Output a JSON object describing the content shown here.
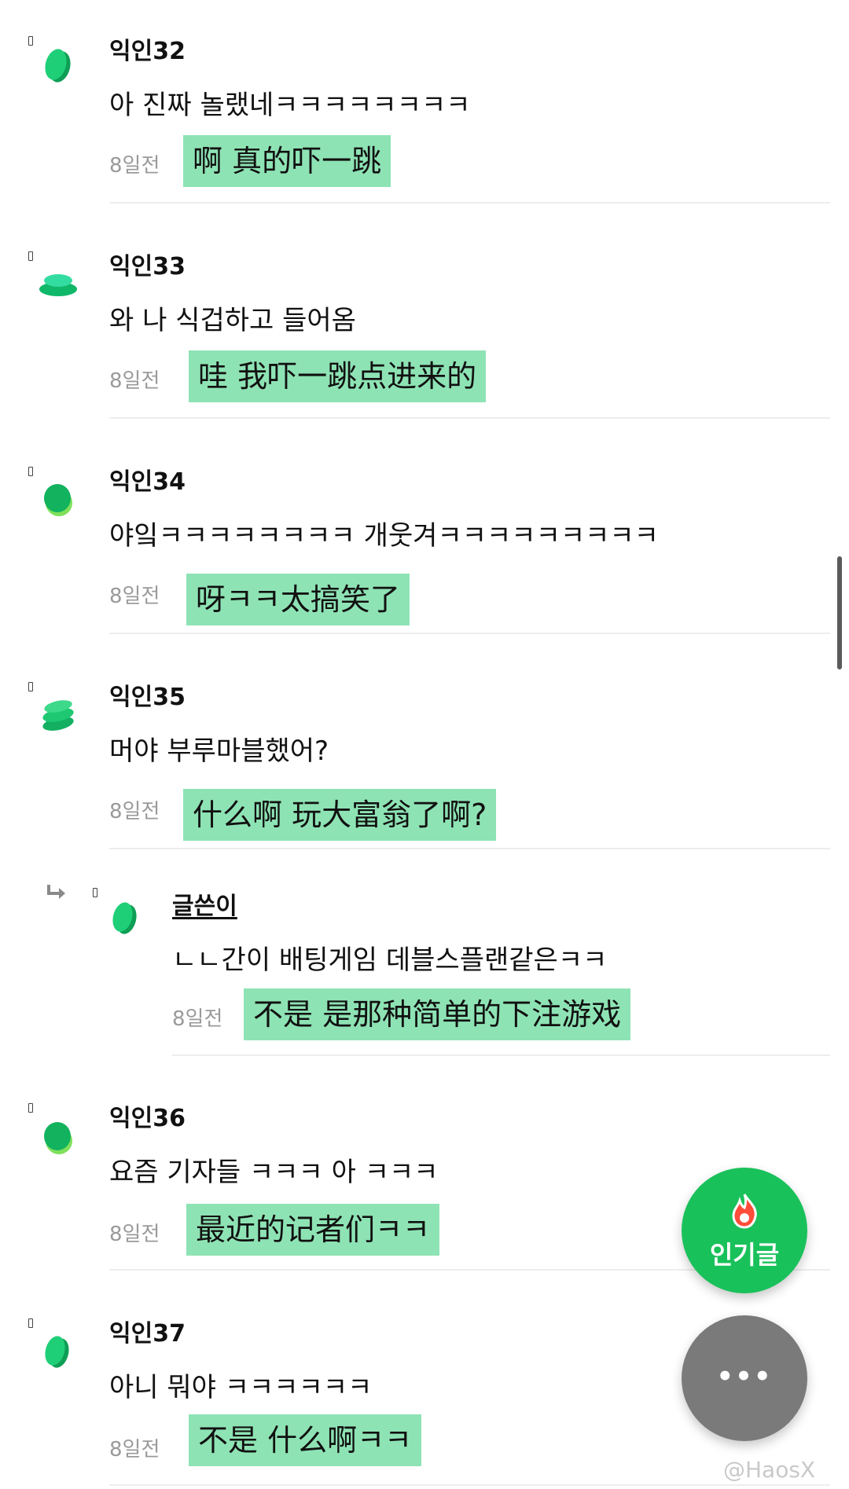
{
  "comments": [
    {
      "name": "익인32",
      "text": "아 진짜 놀랬네ㅋㅋㅋㅋㅋㅋㅋㅋ",
      "date": "8일전",
      "translation": "啊 真的吓一跳"
    },
    {
      "name": "익인33",
      "text": "와 나 식겁하고 들어옴",
      "date": "8일전",
      "translation": "哇 我吓一跳点进来的"
    },
    {
      "name": "익인34",
      "text": "야잌ㅋㅋㅋㅋㅋㅋㅋㅋ 개웃겨ㅋㅋㅋㅋㅋㅋㅋㅋㅋ",
      "date": "8일전",
      "translation": "呀ㅋㅋ太搞笑了"
    },
    {
      "name": "익인35",
      "text": "머야 부루마블했어?",
      "date": "8일전",
      "translation": "什么啊 玩大富翁了啊?"
    },
    {
      "name": "글쓴이",
      "text": "ㄴㄴ간이 배팅게임 데블스플랜같은ㅋㅋ",
      "date": "8일전",
      "translation": "不是 是那种简单的下注游戏"
    },
    {
      "name": "익인36",
      "text": "요즘 기자들 ㅋㅋㅋ 아 ㅋㅋㅋ",
      "date": "8일전",
      "translation": "最近的记者们ㅋㅋ"
    },
    {
      "name": "익인37",
      "text": "아니 뭐야 ㅋㅋㅋㅋㅋㅋ",
      "date": "8일전",
      "translation": "不是 什么啊ㅋㅋ"
    }
  ],
  "fab": {
    "popular_label": "인기글",
    "more_label": "•••"
  },
  "watermark": "@HaosX",
  "colors": {
    "accent_green": "#19c15a",
    "translation_highlight": "#8ee3b4",
    "avatar_green": "#16c270"
  }
}
